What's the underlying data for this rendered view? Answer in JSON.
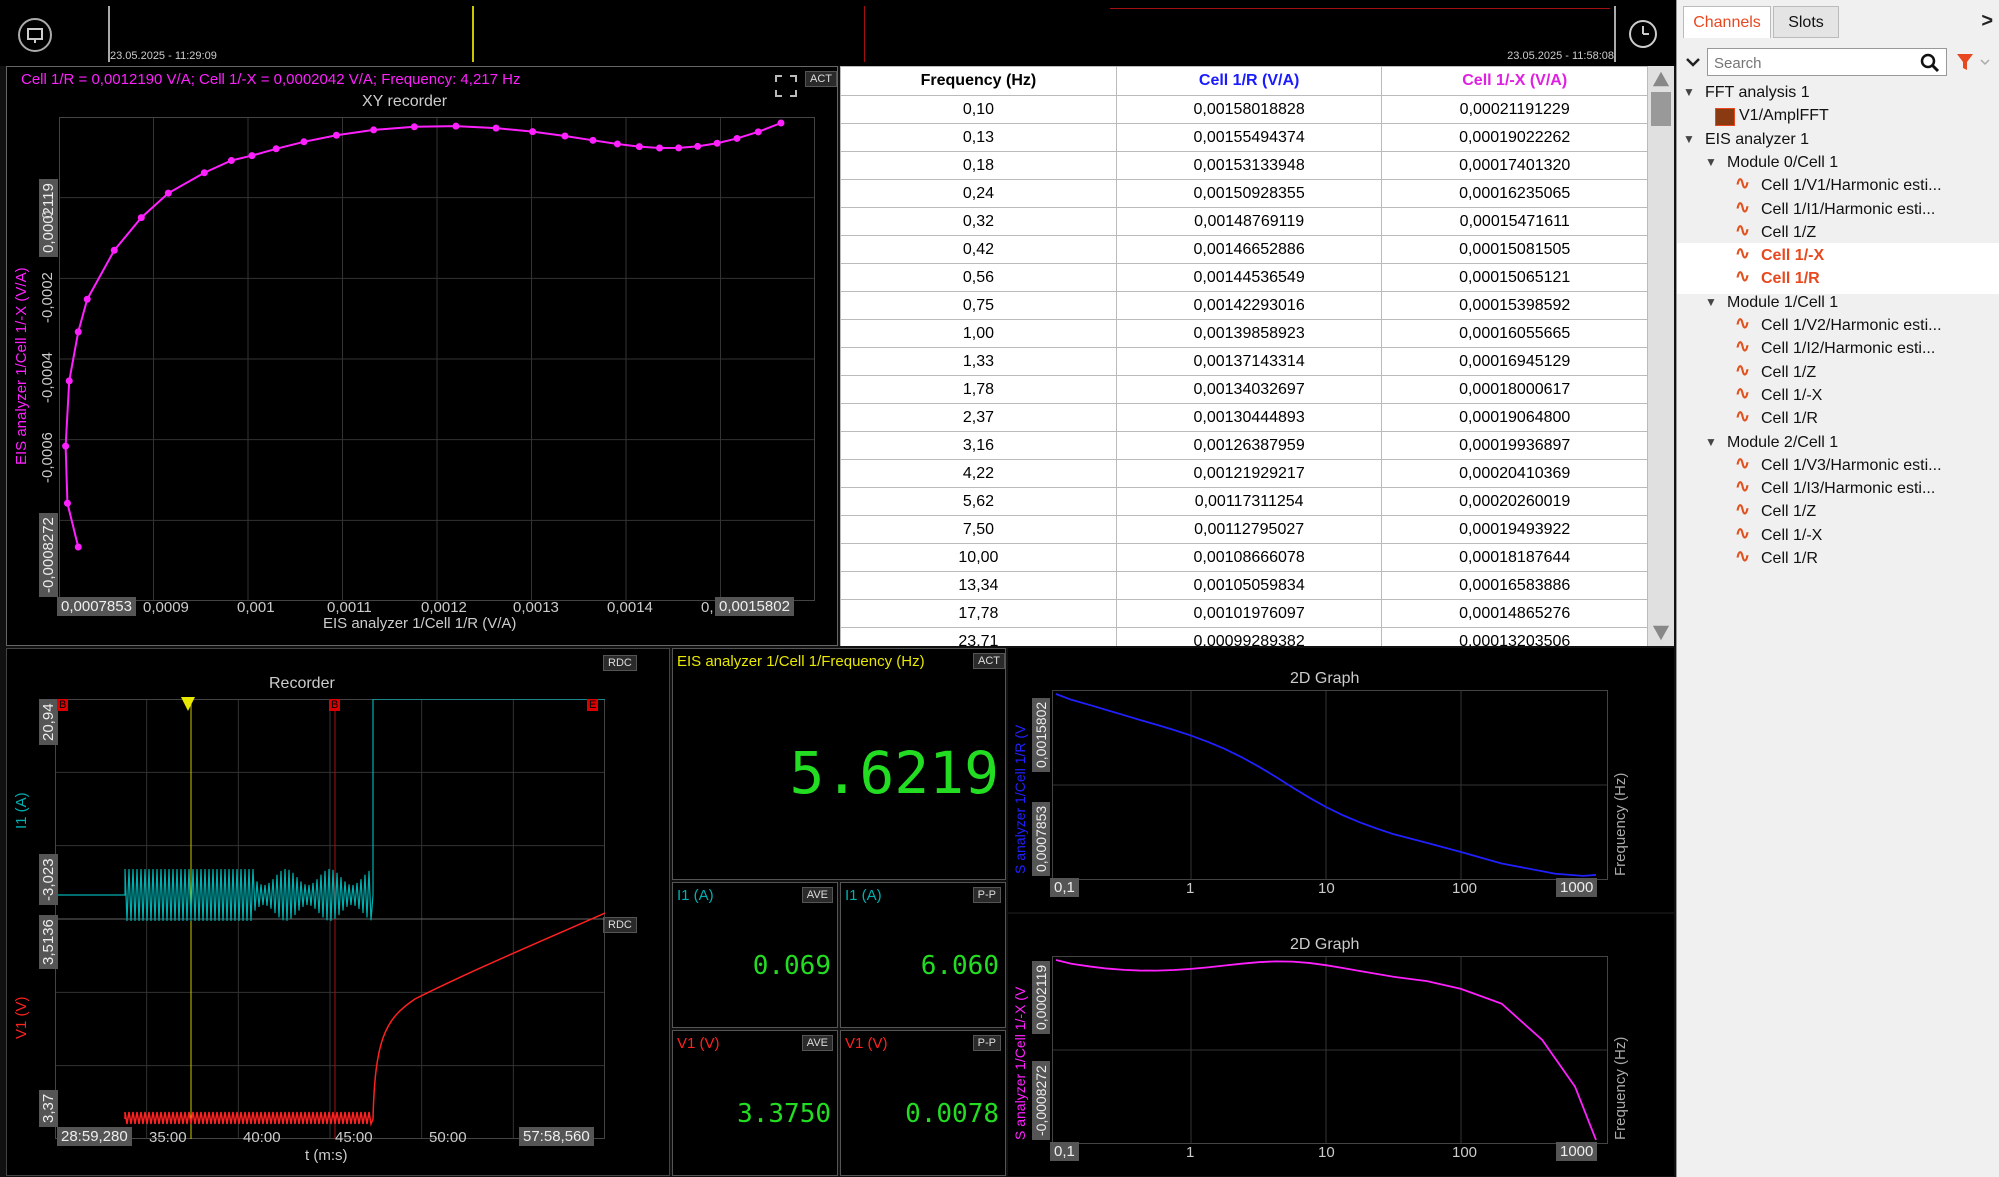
{
  "top_bar": {
    "start_time": "23.05.2025 - 11:29:09",
    "end_time": "23.05.2025 - 11:58:08"
  },
  "xy_recorder": {
    "cursor_readout": "Cell 1/R = 0,0012190 V/A; Cell 1/-X = 0,0002042 V/A; Frequency: 4,217 Hz",
    "title": "XY recorder",
    "badge": "ACT",
    "xlabel": "EIS analyzer 1/Cell 1/R (V/A)",
    "ylabel": "EIS analyzer 1/Cell 1/-X (V/A)",
    "x_min_box": "0,0007853",
    "x_max_box": "0,0015802",
    "x_ticks": [
      "0,0009",
      "0,001",
      "0,0011",
      "0,0012",
      "0,0013",
      "0,0014",
      "0,"
    ],
    "y_max_box": "0,0002119",
    "y_min_box": "-0,0008272",
    "y_ticks": [
      "0",
      "-0,0002",
      "-0,0004",
      "-0,0006"
    ]
  },
  "table": {
    "headers": [
      "Frequency (Hz)",
      "Cell 1/R (V/A)",
      "Cell 1/-X (V/A)"
    ],
    "header_colors": [
      "#000000",
      "#1a1aff",
      "#e020e0"
    ],
    "rows": [
      [
        "0,10",
        "0,00158018828",
        "0,00021191229"
      ],
      [
        "0,13",
        "0,00155494374",
        "0,00019022262"
      ],
      [
        "0,18",
        "0,00153133948",
        "0,00017401320"
      ],
      [
        "0,24",
        "0,00150928355",
        "0,00016235065"
      ],
      [
        "0,32",
        "0,00148769119",
        "0,00015471611"
      ],
      [
        "0,42",
        "0,00146652886",
        "0,00015081505"
      ],
      [
        "0,56",
        "0,00144536549",
        "0,00015065121"
      ],
      [
        "0,75",
        "0,00142293016",
        "0,00015398592"
      ],
      [
        "1,00",
        "0,00139858923",
        "0,00016055665"
      ],
      [
        "1,33",
        "0,00137143314",
        "0,00016945129"
      ],
      [
        "1,78",
        "0,00134032697",
        "0,00018000617"
      ],
      [
        "2,37",
        "0,00130444893",
        "0,00019064800"
      ],
      [
        "3,16",
        "0,00126387959",
        "0,00019936897"
      ],
      [
        "4,22",
        "0,00121929217",
        "0,00020410369"
      ],
      [
        "5,62",
        "0,00117311254",
        "0,00020260019"
      ],
      [
        "7,50",
        "0,00112795027",
        "0,00019493922"
      ],
      [
        "10,00",
        "0,00108666078",
        "0,00018187644"
      ],
      [
        "13,34",
        "0,00105059834",
        "0,00016583886"
      ],
      [
        "17,78",
        "0,00101976097",
        "0,00014865276"
      ],
      [
        "23,71",
        "0,00099289382",
        "0,00013203506"
      ]
    ]
  },
  "recorder": {
    "title": "Recorder",
    "badge_top": "RDC",
    "badge_bottom": "RDC",
    "i1_label": "I1 (A)",
    "v1_label": "V1 (V)",
    "i1_max_box": "20,94",
    "i1_min_box": "-3,023",
    "v1_max_box": "3,5136",
    "v1_min_box": "3,37",
    "t_start_box": "28:59,280",
    "t_end_box": "57:58,560",
    "t_ticks": [
      "35:00",
      "40:00",
      "45:00",
      "50:00"
    ],
    "xlabel": "t (m:s)",
    "marker_b": "B",
    "marker_e": "E"
  },
  "frequency_meter": {
    "title": "EIS analyzer 1/Cell 1/Frequency (Hz)",
    "badge": "ACT",
    "value": "5.6219"
  },
  "meters": [
    {
      "title": "I1 (A)",
      "badge": "AVE",
      "value": "0.069",
      "color": "#00b0b0"
    },
    {
      "title": "I1 (A)",
      "badge": "P-P",
      "value": "6.060",
      "color": "#00b0b0"
    },
    {
      "title": "V1 (V)",
      "badge": "AVE",
      "value": "3.3750",
      "color": "#ff2020"
    },
    {
      "title": "V1 (V)",
      "badge": "P-P",
      "value": "0.0078",
      "color": "#ff2020"
    }
  ],
  "graph1": {
    "title": "2D Graph",
    "ylabel": "S analyzer 1/Cell 1/R (V",
    "y_max_box": "0,0015802",
    "y_min_box": "0,0007853",
    "x_min_box": "0,1",
    "x_max_box": "1000",
    "x_ticks": [
      "1",
      "10",
      "100"
    ],
    "right_label": "Frequency (Hz)"
  },
  "graph2": {
    "title": "2D Graph",
    "ylabel": "S analyzer 1/Cell 1/-X (V",
    "y_max_box": "0,0002119",
    "y_min_box": "-0,0008272",
    "x_min_box": "0,1",
    "x_max_box": "1000",
    "x_ticks": [
      "1",
      "10",
      "100"
    ],
    "right_label": "Frequency (Hz)"
  },
  "sidebar": {
    "tab_channels": "Channels",
    "tab_slots": "Slots",
    "search_placeholder": "Search",
    "collapse_arrow": ">",
    "items": [
      {
        "label": "FFT analysis 1",
        "level": 0,
        "type": "group"
      },
      {
        "label": "V1/AmplFFT",
        "level": 1,
        "type": "fft"
      },
      {
        "label": "EIS analyzer 1",
        "level": 0,
        "type": "group"
      },
      {
        "label": "Module 0/Cell 1",
        "level": 1,
        "type": "group"
      },
      {
        "label": "Cell 1/V1/Harmonic esti...",
        "level": 2,
        "type": "wave"
      },
      {
        "label": "Cell 1/I1/Harmonic esti...",
        "level": 2,
        "type": "wave"
      },
      {
        "label": "Cell 1/Z",
        "level": 2,
        "type": "wave"
      },
      {
        "label": "Cell 1/-X",
        "level": 2,
        "type": "wave",
        "selected": true
      },
      {
        "label": "Cell 1/R",
        "level": 2,
        "type": "wave",
        "selected": true
      },
      {
        "label": "Module 1/Cell 1",
        "level": 1,
        "type": "group"
      },
      {
        "label": "Cell 1/V2/Harmonic esti...",
        "level": 2,
        "type": "wave"
      },
      {
        "label": "Cell 1/I2/Harmonic esti...",
        "level": 2,
        "type": "wave"
      },
      {
        "label": "Cell 1/Z",
        "level": 2,
        "type": "wave"
      },
      {
        "label": "Cell 1/-X",
        "level": 2,
        "type": "wave"
      },
      {
        "label": "Cell 1/R",
        "level": 2,
        "type": "wave"
      },
      {
        "label": "Module 2/Cell 1",
        "level": 1,
        "type": "group"
      },
      {
        "label": "Cell 1/V3/Harmonic esti...",
        "level": 2,
        "type": "wave"
      },
      {
        "label": "Cell 1/I3/Harmonic esti...",
        "level": 2,
        "type": "wave"
      },
      {
        "label": "Cell 1/Z",
        "level": 2,
        "type": "wave"
      },
      {
        "label": "Cell 1/-X",
        "level": 2,
        "type": "wave"
      },
      {
        "label": "Cell 1/R",
        "level": 2,
        "type": "wave"
      }
    ]
  },
  "colors": {
    "magenta": "#ff20ff",
    "blue": "#2020ff",
    "cyan": "#00b0b0",
    "red": "#ff2020",
    "green": "#22dd22",
    "yellow": "#e8e800",
    "accent": "#e8481f"
  }
}
